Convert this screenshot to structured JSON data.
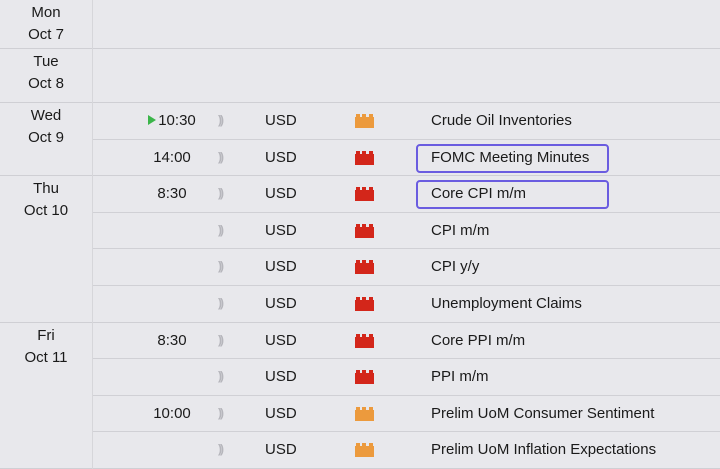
{
  "colors": {
    "high_impact": "#d3261a",
    "medium_impact": "#ec9a3d",
    "highlight_border": "#6a5ce0",
    "play_icon": "#3bb54a"
  },
  "days": [
    {
      "day": "Mon",
      "date": "Oct 7",
      "events": []
    },
    {
      "day": "Tue",
      "date": "Oct 8",
      "events": []
    },
    {
      "day": "Wed",
      "date": "Oct 9",
      "events": [
        {
          "time": "10:30",
          "playing": true,
          "currency": "USD",
          "impact": "medium",
          "title": "Crude Oil Inventories",
          "highlighted": false
        },
        {
          "time": "14:00",
          "playing": false,
          "currency": "USD",
          "impact": "high",
          "title": "FOMC Meeting Minutes",
          "highlighted": true
        }
      ]
    },
    {
      "day": "Thu",
      "date": "Oct 10",
      "events": [
        {
          "time": "8:30",
          "playing": false,
          "currency": "USD",
          "impact": "high",
          "title": "Core CPI m/m",
          "highlighted": true
        },
        {
          "time": "",
          "playing": false,
          "currency": "USD",
          "impact": "high",
          "title": "CPI m/m",
          "highlighted": false
        },
        {
          "time": "",
          "playing": false,
          "currency": "USD",
          "impact": "high",
          "title": "CPI y/y",
          "highlighted": false
        },
        {
          "time": "",
          "playing": false,
          "currency": "USD",
          "impact": "high",
          "title": "Unemployment Claims",
          "highlighted": false
        }
      ]
    },
    {
      "day": "Fri",
      "date": "Oct 11",
      "events": [
        {
          "time": "8:30",
          "playing": false,
          "currency": "USD",
          "impact": "high",
          "title": "Core PPI m/m",
          "highlighted": false
        },
        {
          "time": "",
          "playing": false,
          "currency": "USD",
          "impact": "high",
          "title": "PPI m/m",
          "highlighted": false
        },
        {
          "time": "10:00",
          "playing": false,
          "currency": "USD",
          "impact": "medium",
          "title": "Prelim UoM Consumer Sentiment",
          "highlighted": false
        },
        {
          "time": "",
          "playing": false,
          "currency": "USD",
          "impact": "medium",
          "title": "Prelim UoM Inflation Expectations",
          "highlighted": false
        }
      ]
    }
  ]
}
